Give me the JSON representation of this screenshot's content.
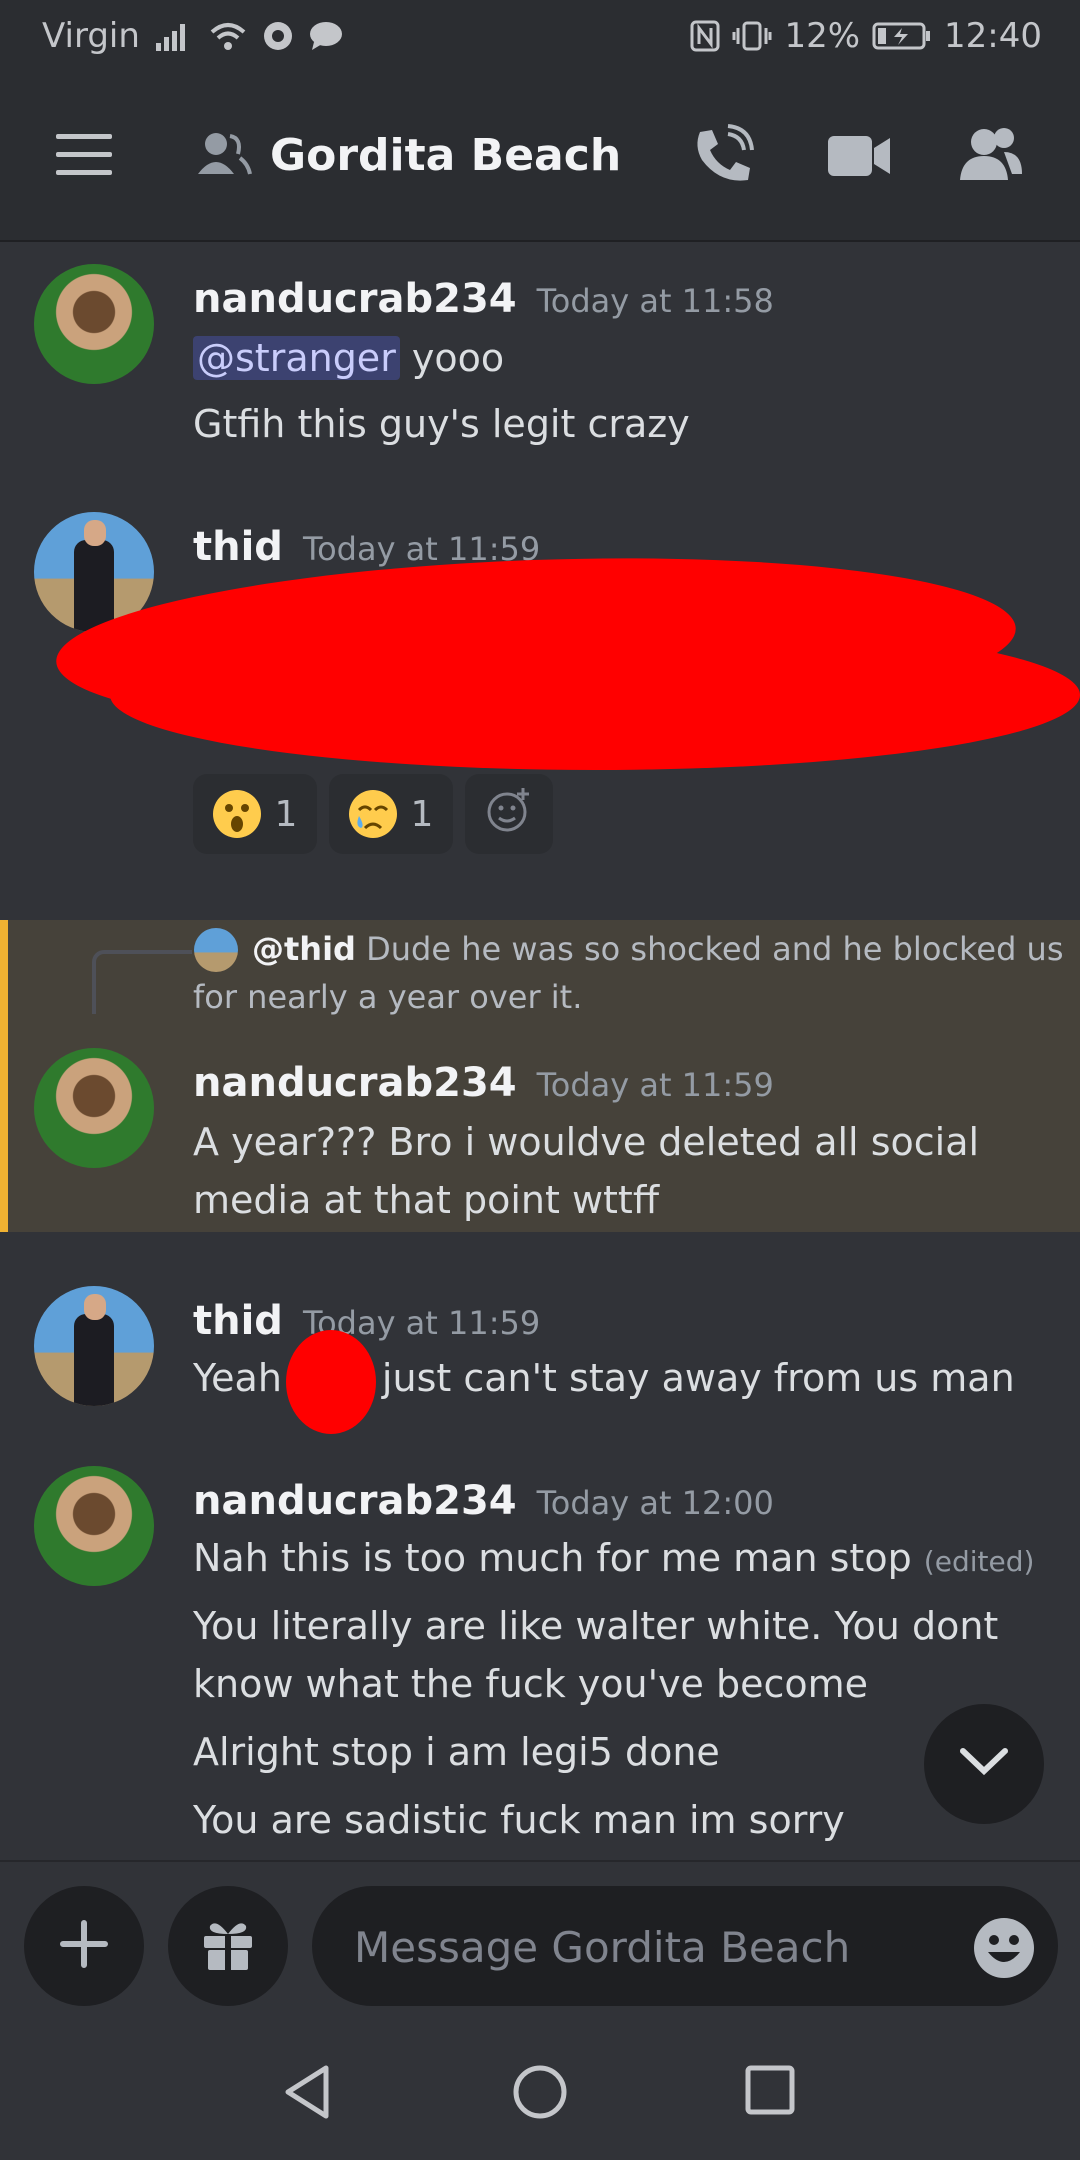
{
  "status_bar": {
    "carrier": "Virgin",
    "battery": "12%",
    "time": "12:40"
  },
  "header": {
    "channel_title": "Gordita Beach"
  },
  "messages": [
    {
      "username": "nanducrab234",
      "timestamp": "Today at 11:58",
      "mention": "@stranger",
      "lines": [
        "yooo",
        "Gtfih this guy's legit crazy"
      ]
    },
    {
      "username": "thid",
      "timestamp": "Today at 11:59",
      "reactions": [
        {
          "emoji": "astonished-face",
          "count": "1"
        },
        {
          "emoji": "crying-face",
          "count": "1"
        }
      ]
    },
    {
      "reply_user": "@thid",
      "reply_text_1": "Dude he was so shocked and he blocked us",
      "reply_text_2": "for nearly a year over it.",
      "username": "nanducrab234",
      "timestamp": "Today at 11:59",
      "lines": [
        "A year??? Bro i wouldve deleted all social",
        "media at that point wttff"
      ]
    },
    {
      "username": "thid",
      "timestamp": "Today at 11:59",
      "line_start": "Yeah",
      "line_end": "just can't stay away from us man"
    },
    {
      "username": "nanducrab234",
      "timestamp": "Today at 12:00",
      "lines": [
        "Nah this is too much for me man stop",
        "You literally are like walter white. You dont",
        "know what the fuck you've become",
        "Alright stop i am legi5 done",
        "You are sadistic fuck man im sorry"
      ],
      "edited": "(edited)"
    }
  ],
  "composer": {
    "placeholder": "Message Gordita Beach"
  },
  "colors": {
    "background": "#313338",
    "header": "#2b2d31",
    "highlight": "#46423a",
    "highlight_bar": "#f0b232",
    "mention": "#3c4270",
    "redaction": "#ff0000"
  },
  "icons": [
    "hamburger-icon",
    "group-dm-icon",
    "call-icon",
    "video-icon",
    "members-icon",
    "add-reaction-icon",
    "chevron-down-icon",
    "plus-icon",
    "gift-icon",
    "emoji-icon",
    "back-icon",
    "home-icon",
    "recents-icon"
  ]
}
